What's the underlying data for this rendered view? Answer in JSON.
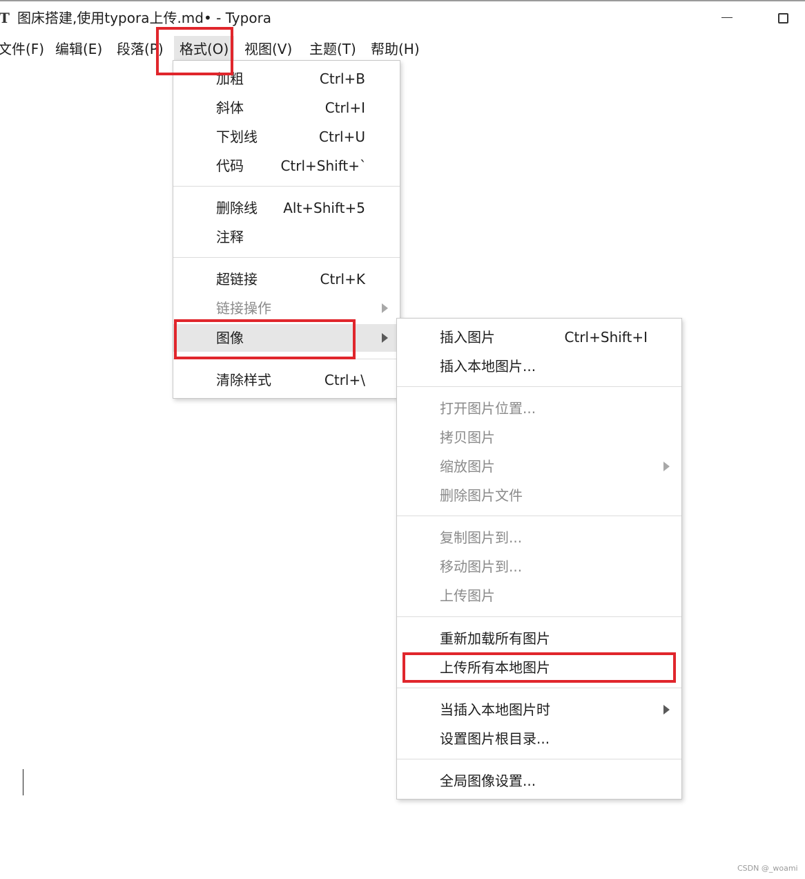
{
  "window": {
    "app_icon": "T",
    "title": "图床搭建,使用typora上传.md• - Typora"
  },
  "menubar": [
    {
      "label": "文件(F)"
    },
    {
      "label": "编辑(E)"
    },
    {
      "label": "段落(P)"
    },
    {
      "label": "格式(O)"
    },
    {
      "label": "视图(V)"
    },
    {
      "label": "主题(T)"
    },
    {
      "label": "帮助(H)"
    }
  ],
  "format_menu": {
    "items": [
      {
        "label": "加粗",
        "shortcut": "Ctrl+B"
      },
      {
        "label": "斜体",
        "shortcut": "Ctrl+I"
      },
      {
        "label": "下划线",
        "shortcut": "Ctrl+U"
      },
      {
        "label": "代码",
        "shortcut": "Ctrl+Shift+`"
      },
      {
        "label": "删除线",
        "shortcut": "Alt+Shift+5"
      },
      {
        "label": "注释",
        "shortcut": ""
      },
      {
        "label": "超链接",
        "shortcut": "Ctrl+K"
      },
      {
        "label": "链接操作",
        "shortcut": ""
      },
      {
        "label": "图像",
        "shortcut": ""
      },
      {
        "label": "清除样式",
        "shortcut": "Ctrl+\\"
      }
    ]
  },
  "image_submenu": {
    "items": [
      {
        "label": "插入图片",
        "shortcut": "Ctrl+Shift+I"
      },
      {
        "label": "插入本地图片..."
      },
      {
        "label": "打开图片位置..."
      },
      {
        "label": "拷贝图片"
      },
      {
        "label": "缩放图片"
      },
      {
        "label": "删除图片文件"
      },
      {
        "label": "复制图片到..."
      },
      {
        "label": "移动图片到..."
      },
      {
        "label": "上传图片"
      },
      {
        "label": "重新加载所有图片"
      },
      {
        "label": "上传所有本地图片"
      },
      {
        "label": "当插入本地图片时"
      },
      {
        "label": "设置图片根目录..."
      },
      {
        "label": "全局图像设置..."
      }
    ]
  },
  "watermark": "CSDN @_woami",
  "colors": {
    "highlight_box": "#e0262c",
    "menu_hover": "#e6e6e6",
    "disabled_text": "#8a8a8a"
  }
}
